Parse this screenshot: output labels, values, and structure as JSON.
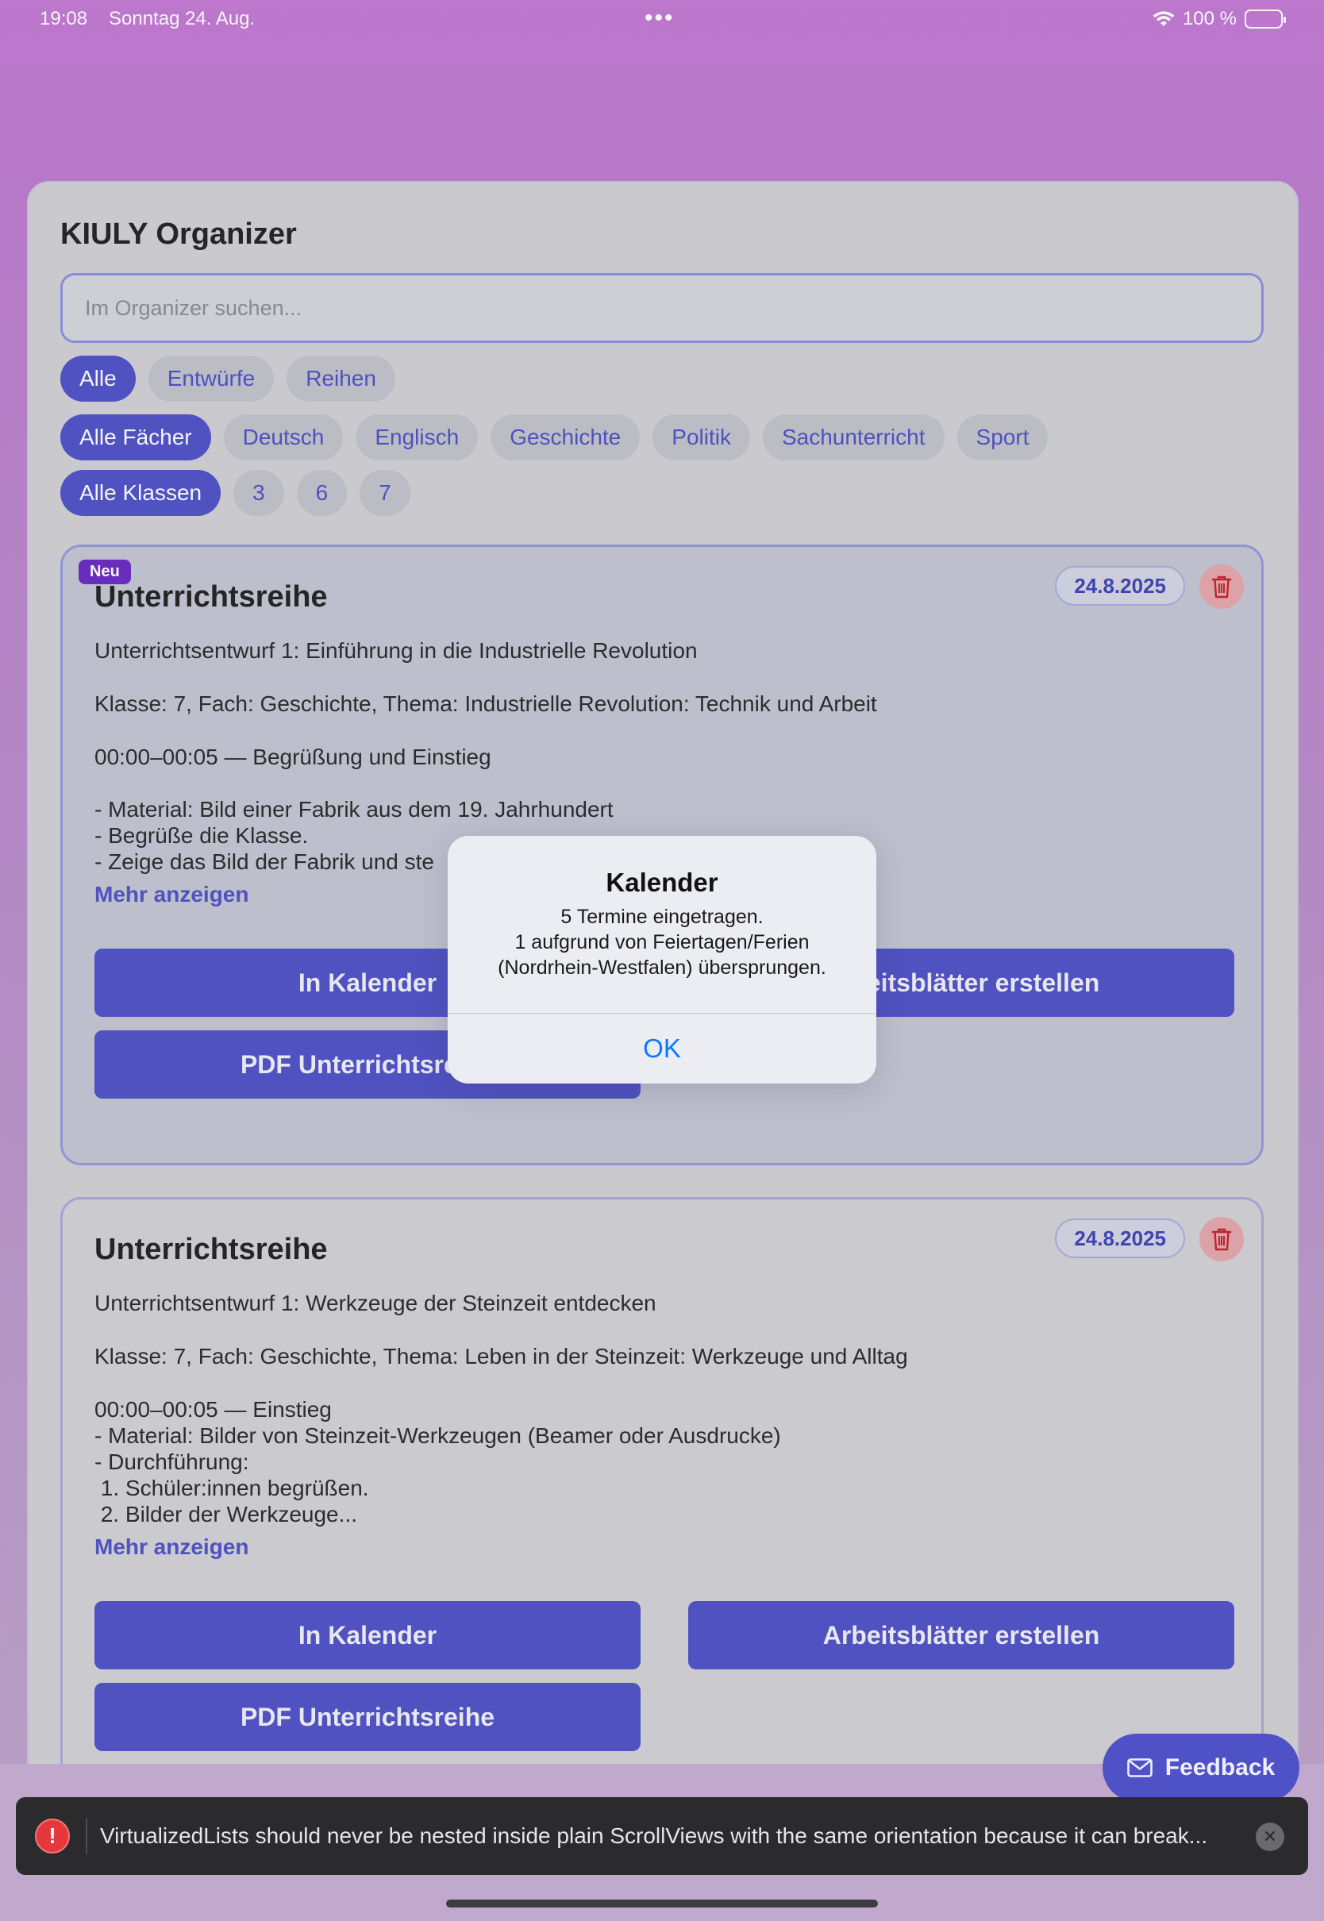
{
  "status_bar": {
    "time": "19:08",
    "date": "Sonntag 24. Aug.",
    "dots": "•••",
    "battery": "100 %"
  },
  "app": {
    "title": "KIULY Organizer",
    "search_placeholder": "Im Organizer suchen..."
  },
  "filters": {
    "type": [
      "Alle",
      "Entwürfe",
      "Reihen"
    ],
    "subjects": [
      "Alle Fächer",
      "Deutsch",
      "Englisch",
      "Geschichte",
      "Politik",
      "Sachunterricht",
      "Sport"
    ],
    "classes": [
      "Alle Klassen",
      "3",
      "6",
      "7"
    ]
  },
  "lessons": [
    {
      "badge": "Neu",
      "title": "Unterrichtsreihe",
      "date": "24.8.2025",
      "line1": "Unterrichtsentwurf 1: Einführung in die Industrielle Revolution",
      "line2": "Klasse: 7, Fach: Geschichte, Thema: Industrielle Revolution: Technik und Arbeit",
      "line3": "00:00–00:05 — Begrüßung und Einstieg",
      "line4": "- Material: Bild einer Fabrik aus dem 19. Jahrhundert",
      "line5": "- Begrüße die Klasse.",
      "line6": "- Zeige das Bild der Fabrik und ste",
      "more": "Mehr anzeigen",
      "btn_calendar": "In Kalender",
      "btn_worksheets": "Arbeitsblätter erstellen",
      "btn_pdf": "PDF Unterrichtsreihe"
    },
    {
      "title": "Unterrichtsreihe",
      "date": "24.8.2025",
      "line1": "Unterrichtsentwurf 1: Werkzeuge der Steinzeit entdecken",
      "line2": "Klasse: 7, Fach: Geschichte, Thema: Leben in der Steinzeit: Werkzeuge und Alltag",
      "line3": "00:00–00:05 — Einstieg",
      "line4": "- Material: Bilder von Steinzeit-Werkzeugen (Beamer oder Ausdrucke)",
      "line5": "- Durchführung:",
      "line6": " 1. Schüler:innen begrüßen.",
      "line7": " 2. Bilder der Werkzeuge...",
      "more": "Mehr anzeigen",
      "btn_calendar": "In Kalender",
      "btn_worksheets": "Arbeitsblätter erstellen",
      "btn_pdf": "PDF Unterrichtsreihe"
    }
  ],
  "alert": {
    "title": "Kalender",
    "line1": "5 Termine eingetragen.",
    "line2": "1 aufgrund von Feiertagen/Ferien",
    "line3": "(Nordrhein-Westfalen) übersprungen.",
    "ok": "OK"
  },
  "feedback": {
    "label": "Feedback"
  },
  "error_toast": {
    "message": "VirtualizedLists should never be nested inside plain ScrollViews with the same orientation because it can break..."
  },
  "colors": {
    "accent": "#4f52c6",
    "alert_ok": "#0a7aff",
    "error": "#e5373c"
  }
}
